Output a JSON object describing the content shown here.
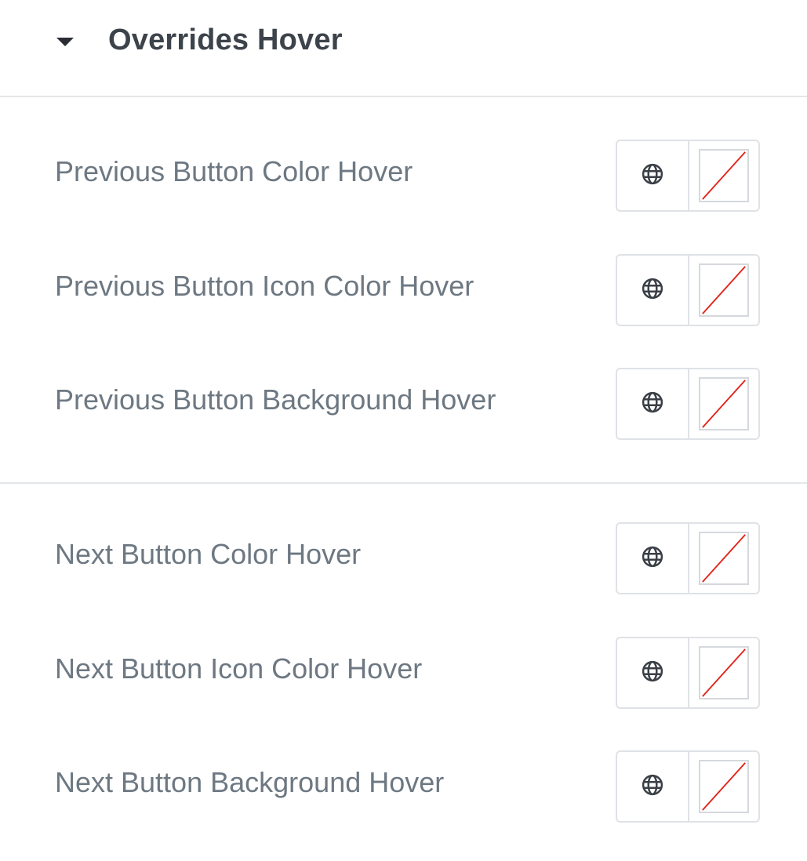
{
  "section": {
    "title": "Overrides Hover",
    "expanded": true,
    "caret_icon": "caret-down-icon"
  },
  "colors": {
    "label": "#6d7882",
    "title": "#3d434b",
    "border": "#dfe2e6",
    "no_color_slash": "#e2231a"
  },
  "groups": [
    {
      "rows": [
        {
          "label": "Previous Button Color Hover",
          "global_icon": "globe-icon",
          "value": "none"
        },
        {
          "label": "Previous Button Icon Color Hover",
          "global_icon": "globe-icon",
          "value": "none"
        },
        {
          "label": "Previous Button Background Hover",
          "global_icon": "globe-icon",
          "value": "none"
        }
      ]
    },
    {
      "rows": [
        {
          "label": "Next Button Color Hover",
          "global_icon": "globe-icon",
          "value": "none"
        },
        {
          "label": "Next Button Icon Color Hover",
          "global_icon": "globe-icon",
          "value": "none"
        },
        {
          "label": "Next Button Background Hover",
          "global_icon": "globe-icon",
          "value": "none"
        }
      ]
    }
  ]
}
